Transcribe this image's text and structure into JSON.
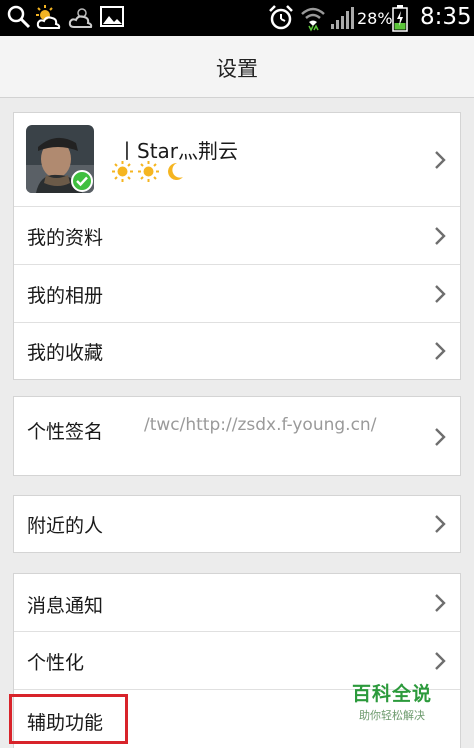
{
  "status_bar": {
    "icons": [
      "search-icon",
      "weather-sunny-cloud-icon",
      "weather-cloud-icon",
      "image-icon",
      "alarm-icon",
      "wifi-icon",
      "signal-icon",
      "battery-charging-icon"
    ],
    "battery": "28%",
    "time": "8:35"
  },
  "header": {
    "title": "设置"
  },
  "profile": {
    "nickname": "丨Star灬荆云",
    "level_badges": [
      "sun-icon",
      "sun-icon",
      "moon-icon"
    ],
    "verified_icon": "check-icon"
  },
  "group1": {
    "items": [
      {
        "label": "我的资料"
      },
      {
        "label": "我的相册"
      },
      {
        "label": "我的收藏"
      }
    ]
  },
  "signature": {
    "label": "个性签名",
    "value": "/twc/http://zsdx.f-young.cn/"
  },
  "group3": {
    "items": [
      {
        "label": "附近的人"
      }
    ]
  },
  "group4": {
    "items": [
      {
        "label": "消息通知"
      },
      {
        "label": "个性化"
      },
      {
        "label": "辅助功能"
      }
    ]
  },
  "watermark": {
    "main": "百科全说",
    "sub": "助你轻松解决"
  },
  "colors": {
    "highlight": "#d8232a",
    "watermark": "#2c9a3c",
    "background": "#ececec"
  }
}
